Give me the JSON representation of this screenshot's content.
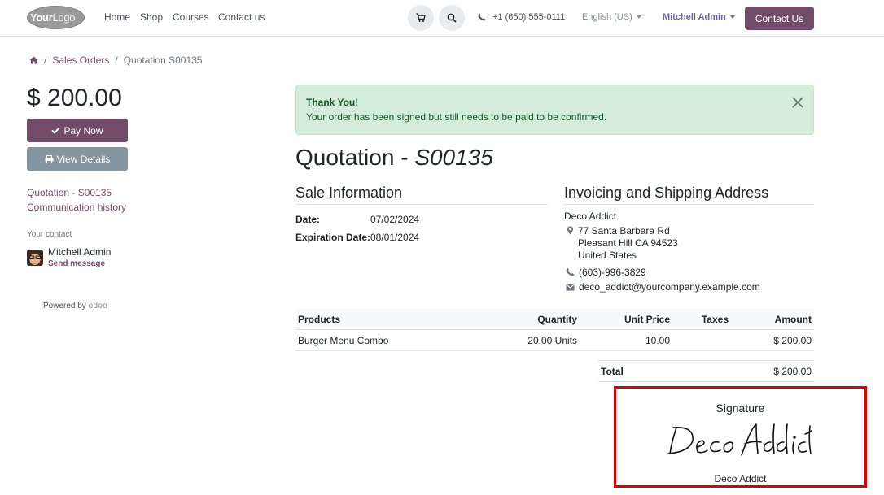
{
  "header": {
    "logo": {
      "bold": "Your",
      "light": "Logo"
    },
    "nav": [
      "Home",
      "Shop",
      "Courses",
      "Contact us"
    ],
    "phone": "+1 (650) 555-0111",
    "language": "English (US)",
    "user": "Mitchell Admin",
    "contact_button": "Contact Us"
  },
  "breadcrumb": {
    "items": [
      "Sales Orders",
      "Quotation S00135"
    ]
  },
  "sidebar": {
    "amount": "$ 200.00",
    "pay_button": "Pay Now",
    "view_button": "View Details",
    "links": [
      "Quotation - S00135",
      "Communication history"
    ],
    "contact_label": "Your contact",
    "contact_name": "Mitchell Admin",
    "send_message": "Send message",
    "powered_by": "Powered by",
    "powered_brand": "odoo"
  },
  "alert": {
    "title": "Thank You!",
    "message": "Your order has been signed but still needs to be paid to be confirmed."
  },
  "quotation": {
    "title_prefix": "Quotation - ",
    "reference": "S00135"
  },
  "sale_info": {
    "title": "Sale Information",
    "date_label": "Date:",
    "date_value": "07/02/2024",
    "expiration_label": "Expiration Date:",
    "expiration_value": "08/01/2024"
  },
  "address": {
    "title": "Invoicing and Shipping Address",
    "name": "Deco Addict",
    "street": "77 Santa Barbara Rd",
    "city": "Pleasant Hill CA 94523",
    "country": "United States",
    "phone": "(603)-996-3829",
    "email": "deco_addict@yourcompany.example.com"
  },
  "table": {
    "headers": [
      "Products",
      "Quantity",
      "Unit Price",
      "Taxes",
      "Amount"
    ],
    "rows": [
      {
        "product": "Burger Menu Combo",
        "quantity": "20.00 Units",
        "unit_price": "10.00",
        "taxes": "",
        "amount": "$ 200.00"
      }
    ],
    "total_label": "Total",
    "total_value": "$ 200.00"
  },
  "signature": {
    "title": "Signature",
    "signed_name": "Deco Addict",
    "handwritten": "Deco Addict",
    "highlight_color": "#e00000"
  },
  "colors": {
    "brand": "#714b67",
    "secondary_button": "#8595a2",
    "alert_bg": "#d4edda",
    "alert_text": "#155724"
  }
}
